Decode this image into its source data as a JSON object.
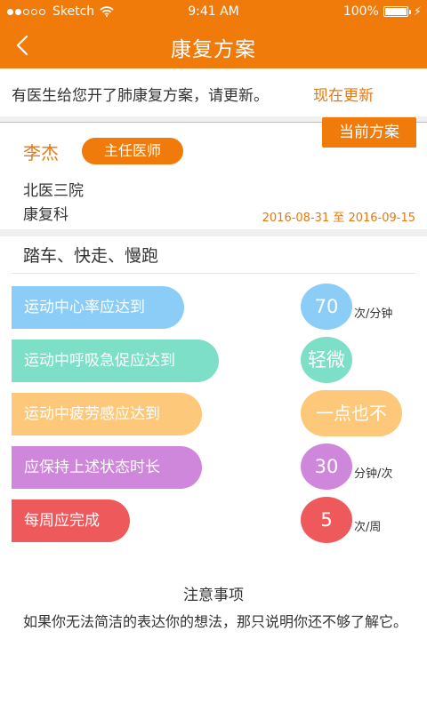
{
  "status_bar": {
    "carrier": "Sketch",
    "time": "9:41 AM",
    "battery": "100%",
    "icons": [
      "signal-dots-icon",
      "wifi-icon",
      "battery-icon",
      "charging-bolt-icon"
    ]
  },
  "header": {
    "title": "康复方案",
    "back_icon": "chevron-left-icon"
  },
  "notice": {
    "text": "有医生给您开了肺康复方案，请更新。",
    "action": "现在更新"
  },
  "plan": {
    "current_tag": "当前方案",
    "doctor_name": "李杰",
    "doctor_title": "主任医师",
    "hospital": "北医三院",
    "department": "康复科",
    "date_range": "2016-08-31 至 2016-09-15"
  },
  "exercise": {
    "title": "踏车、快走、慢跑",
    "items": [
      {
        "label": "运动中心率应达到",
        "value": "70",
        "unit": "次/分钟",
        "color": "#8ccdf7"
      },
      {
        "label": "运动中呼吸急促应达到",
        "value": "轻微",
        "unit": "",
        "color": "#7edfc8"
      },
      {
        "label": "运动中疲劳感应达到",
        "value": "一点也不",
        "unit": "",
        "color": "#fdc87a"
      },
      {
        "label": "应保持上述状态时长",
        "value": "30",
        "unit": "分钟/次",
        "color": "#cf87dc"
      },
      {
        "label": "每周应完成",
        "value": "5",
        "unit": "次/周",
        "color": "#ee5a5c"
      }
    ]
  },
  "notes": {
    "title": "注意事项",
    "text": "如果你无法简洁的表达你的想法，那只说明你还不够了解它。"
  },
  "colors": {
    "brand_orange": "#f07a0a",
    "accent_text_orange": "#e8780e",
    "background": "#f0f0f0"
  }
}
